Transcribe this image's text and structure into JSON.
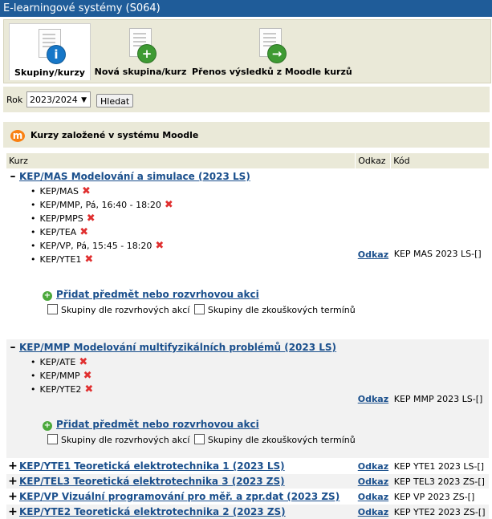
{
  "window": {
    "title": "E-learningové systémy (S064)"
  },
  "toolbar": {
    "buttons": [
      {
        "label": "Skupiny/kurzy",
        "badge": "i",
        "color": "#1677c8"
      },
      {
        "label": "Nová skupina/kurz",
        "badge": "+",
        "color": "#3e9a33"
      },
      {
        "label": "Přenos výsledků z Moodle kurzů",
        "badge": "→",
        "color": "#3e9a33"
      }
    ]
  },
  "filter": {
    "rok_label": "Rok",
    "year": "2023/2024",
    "search_label": "Hledat"
  },
  "section": {
    "logo": "m",
    "title": "Kurzy založené v systému Moodle"
  },
  "table": {
    "headers": [
      "Kurz",
      "Odkaz",
      "Kód"
    ],
    "link_label": "Odkaz",
    "add_label": "Přidat předmět nebo rozvrhovou akci",
    "chk_groups": "Skupiny dle rozvrhových akcí",
    "chk_exams": "Skupiny dle zkouškových termínů",
    "expanded": [
      {
        "sign": "–",
        "title": "KEP/MAS Modelování a simulace (2023 LS)",
        "code": "KEP MAS 2023 LS-[]",
        "items": [
          "KEP/MAS",
          "KEP/MMP, Pá, 16:40 - 18:20",
          "KEP/PMPS",
          "KEP/TEA",
          "KEP/VP, Pá, 15:45 - 18:20",
          "KEP/YTE1"
        ]
      },
      {
        "sign": "–",
        "title": "KEP/MMP Modelování multifyzikálních problémů (2023 LS)",
        "code": "KEP MMP 2023 LS-[]",
        "items": [
          "KEP/ATE",
          "KEP/MMP",
          "KEP/YTE2"
        ]
      }
    ],
    "collapsed": [
      {
        "sign": "+",
        "title": "KEP/YTE1 Teoretická elektrotechnika 1 (2023 LS)",
        "code": "KEP YTE1 2023 LS-[]"
      },
      {
        "sign": "+",
        "title": "KEP/TEL3 Teoretická elektrotechnika 3 (2023 ZS)",
        "code": "KEP TEL3 2023 ZS-[]"
      },
      {
        "sign": "+",
        "title": "KEP/VP Vizuální programování pro měř. a zpr.dat (2023 ZS)",
        "code": "KEP VP 2023 ZS-[]"
      },
      {
        "sign": "+",
        "title": "KEP/YTE2 Teoretická elektrotechnika 2 (2023 ZS)",
        "code": "KEP YTE2 2023 ZS-[]"
      }
    ]
  }
}
